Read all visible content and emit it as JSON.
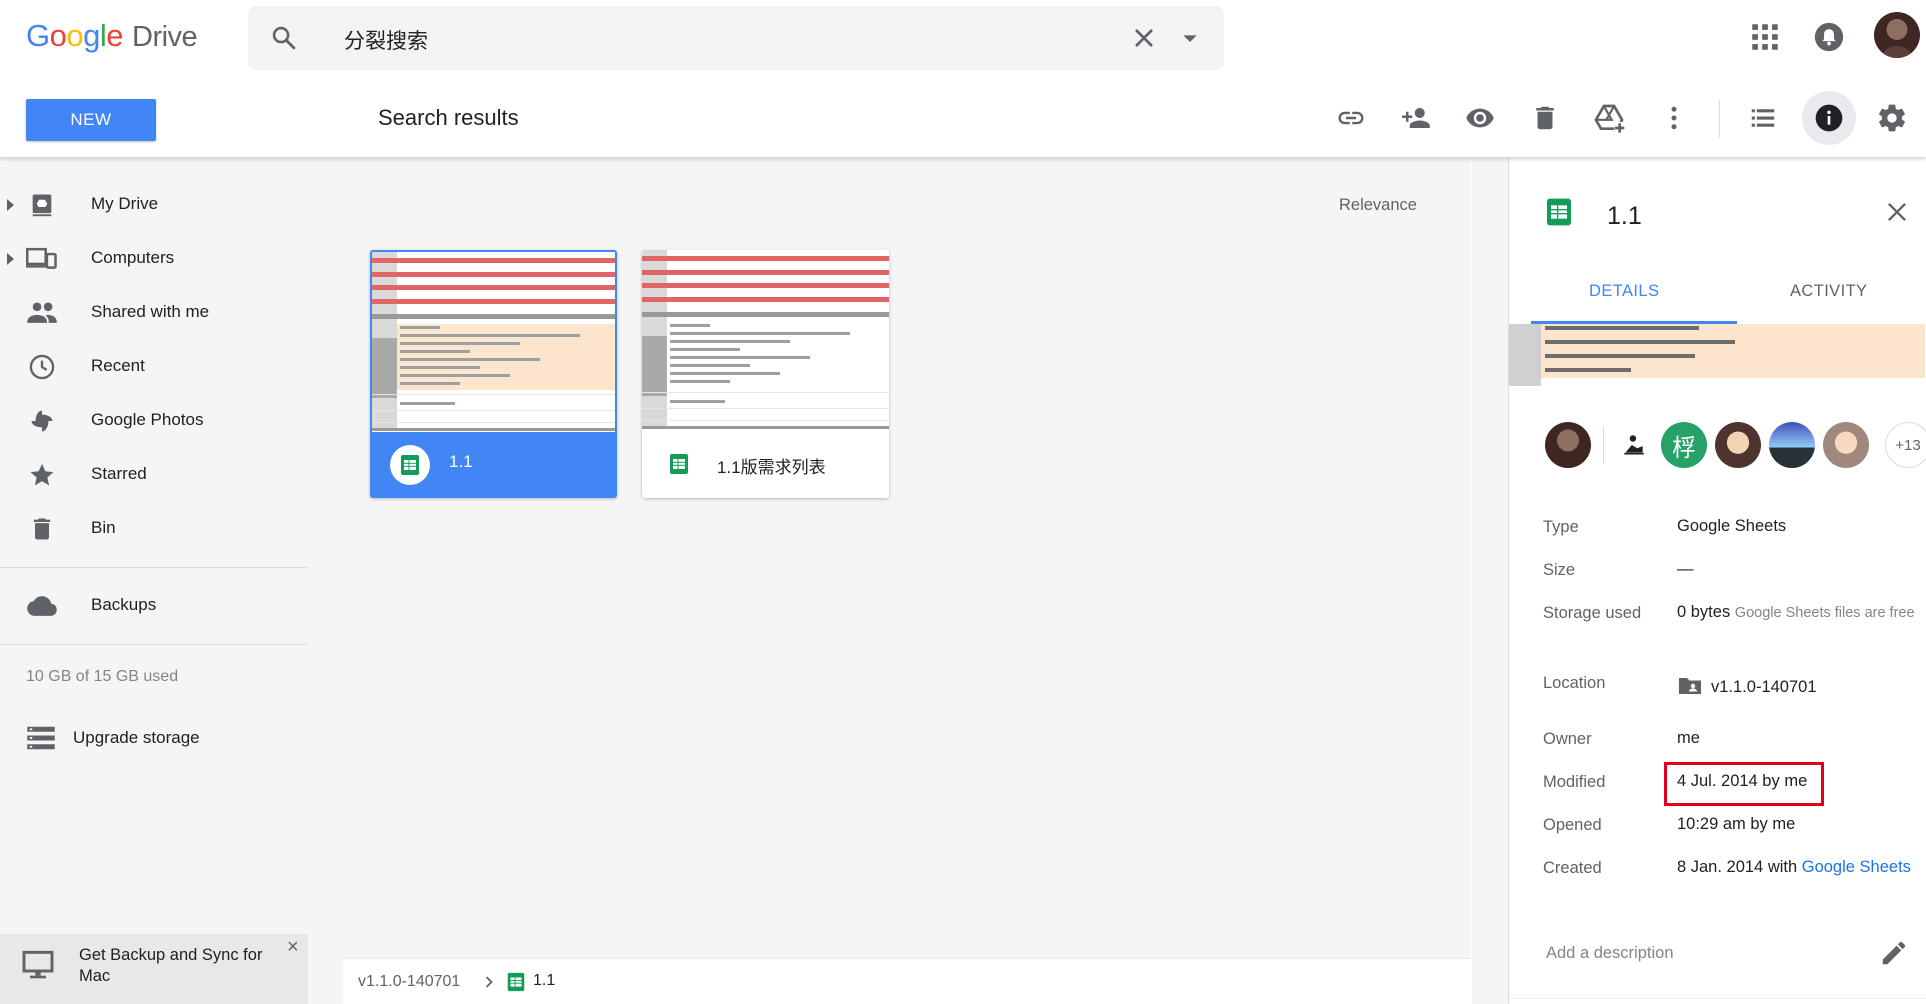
{
  "header": {
    "logo_letters": [
      "G",
      "o",
      "o",
      "g",
      "l",
      "e"
    ],
    "product": "Drive",
    "search_value": "分裂搜索",
    "icons": [
      "apps-grid-icon",
      "notifications-icon",
      "account-avatar"
    ]
  },
  "toolbar": {
    "new_label": "NEW",
    "heading": "Search results",
    "icons": [
      "link-icon",
      "share-person-icon",
      "preview-eye-icon",
      "trash-icon",
      "add-to-drive-icon",
      "more-vert-icon",
      "list-view-icon",
      "info-icon",
      "settings-gear-icon"
    ]
  },
  "sidebar": {
    "items": [
      {
        "label": "My Drive",
        "icon": "my-drive-icon",
        "expandable": true
      },
      {
        "label": "Computers",
        "icon": "computers-icon",
        "expandable": true
      },
      {
        "label": "Shared with me",
        "icon": "people-icon",
        "expandable": false
      },
      {
        "label": "Recent",
        "icon": "clock-icon",
        "expandable": false
      },
      {
        "label": "Google Photos",
        "icon": "pinwheel-icon",
        "expandable": false
      },
      {
        "label": "Starred",
        "icon": "star-icon",
        "expandable": false
      },
      {
        "label": "Bin",
        "icon": "trash-icon",
        "expandable": false
      }
    ],
    "backups_label": "Backups",
    "storage_text": "10 GB of 15 GB used",
    "upgrade_label": "Upgrade storage",
    "promo_text": "Get Backup and Sync for Mac",
    "promo_close": "×"
  },
  "main": {
    "sort_label": "Relevance",
    "files": [
      {
        "name": "1.1",
        "selected": true
      },
      {
        "name": "1.1版需求列表",
        "selected": false
      }
    ],
    "breadcrumb": {
      "folder": "v1.1.0-140701",
      "file": "1.1"
    }
  },
  "details": {
    "title": "1.1",
    "tabs": [
      "DETAILS",
      "ACTIVITY"
    ],
    "shared_more": "+13",
    "shared_avatar_text": "桴",
    "rows": {
      "type_label": "Type",
      "type_value": "Google Sheets",
      "size_label": "Size",
      "size_value": "—",
      "storage_label": "Storage used",
      "storage_value": "0 bytes",
      "storage_note": "Google Sheets files are free",
      "location_label": "Location",
      "location_value": "v1.1.0-140701",
      "owner_label": "Owner",
      "owner_value": "me",
      "modified_label": "Modified",
      "modified_value": "4 Jul. 2014 by me",
      "opened_label": "Opened",
      "opened_value": "10:29 am by me",
      "created_label": "Created",
      "created_value": "8 Jan. 2014 with ",
      "created_link": "Google Sheets"
    },
    "description_placeholder": "Add a description"
  },
  "colors": {
    "accent": "#4285f4",
    "sheets_green": "#0f9d58",
    "highlight_red": "#e0001b"
  }
}
